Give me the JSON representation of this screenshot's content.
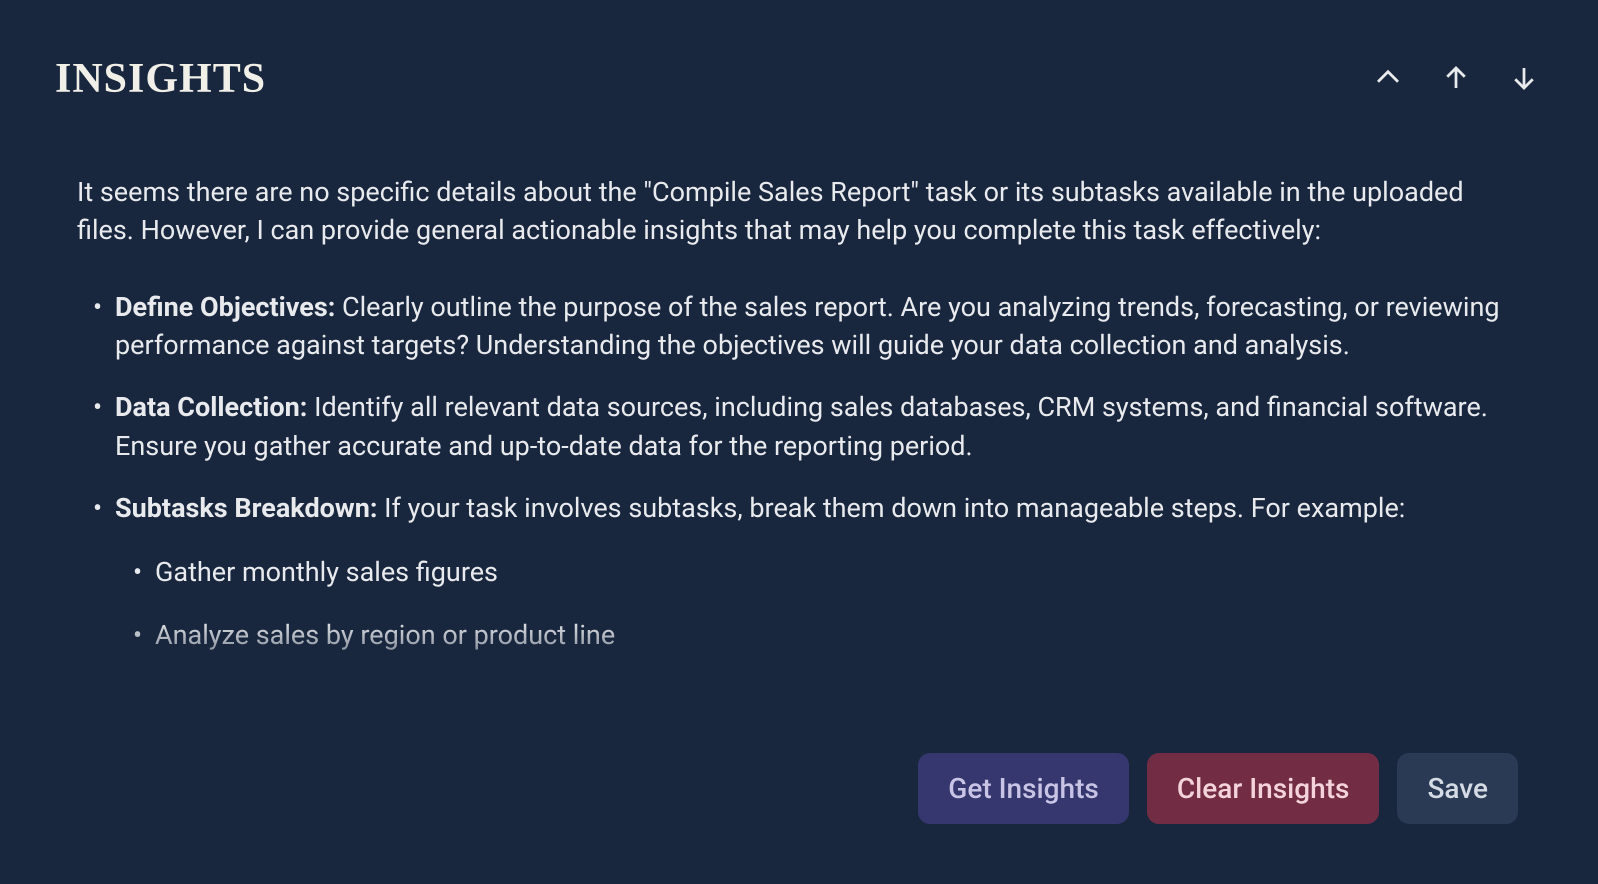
{
  "header": {
    "title": "INSIGHTS"
  },
  "content": {
    "intro": "It seems there are no specific details about the \"Compile Sales Report\" task or its subtasks available in the uploaded files. However, I can provide general actionable insights that may help you complete this task effectively:",
    "items": [
      {
        "title": "Define Objectives:",
        "body": " Clearly outline the purpose of the sales report. Are you analyzing trends, forecasting, or reviewing performance against targets? Understanding the objectives will guide your data collection and analysis."
      },
      {
        "title": "Data Collection:",
        "body": " Identify all relevant data sources, including sales databases, CRM systems, and financial software. Ensure you gather accurate and up-to-date data for the reporting period."
      },
      {
        "title": "Subtasks Breakdown:",
        "body": " If your task involves subtasks, break them down into manageable steps. For example:",
        "subitems": [
          "Gather monthly sales figures",
          "Analyze sales by region or product line"
        ]
      }
    ]
  },
  "buttons": {
    "get": "Get Insights",
    "clear": "Clear Insights",
    "save": "Save"
  }
}
